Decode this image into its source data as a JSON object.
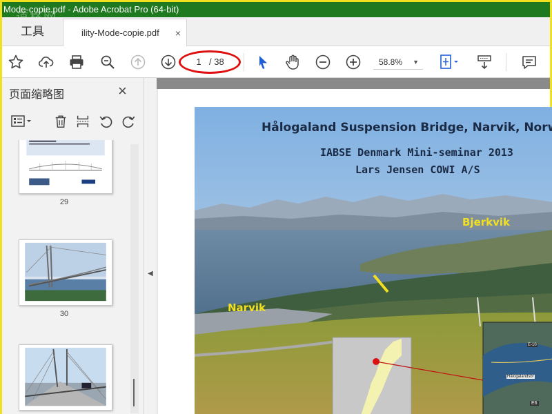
{
  "window": {
    "title": "Mode-copie.pdf - Adobe Acrobat Pro (64-bit)",
    "watermark": "道格网"
  },
  "tabs": {
    "tools_label": "工具",
    "doc_label": "ility-Mode-copie.pdf",
    "close_symbol": "×"
  },
  "toolbar": {
    "page_current": "1",
    "page_total": "/ 38",
    "zoom": "58.8%"
  },
  "sidebar": {
    "title": "页面缩略图",
    "close_symbol": "×",
    "thumbnails": [
      {
        "number": "29"
      },
      {
        "number": "30"
      },
      {
        "number": ""
      }
    ]
  },
  "slide": {
    "title": "Hålogaland Suspension Bridge, Narvik, Norw",
    "subtitle1": "IABSE Denmark Mini-seminar 2013",
    "subtitle2": "Lars Jensen COWI A/S",
    "label_bjerkvik": "Bjerkvik",
    "label_narvik": "Narvik",
    "inset_label1": "E-10",
    "inset_label2": "Hålogalandsbr",
    "inset_label3": "E6"
  },
  "colors": {
    "titlebar": "#1f7a1f",
    "highlight_ellipse": "#e01010",
    "label_yellow": "#f2e020",
    "cursor_blue": "#1e5ed6"
  }
}
